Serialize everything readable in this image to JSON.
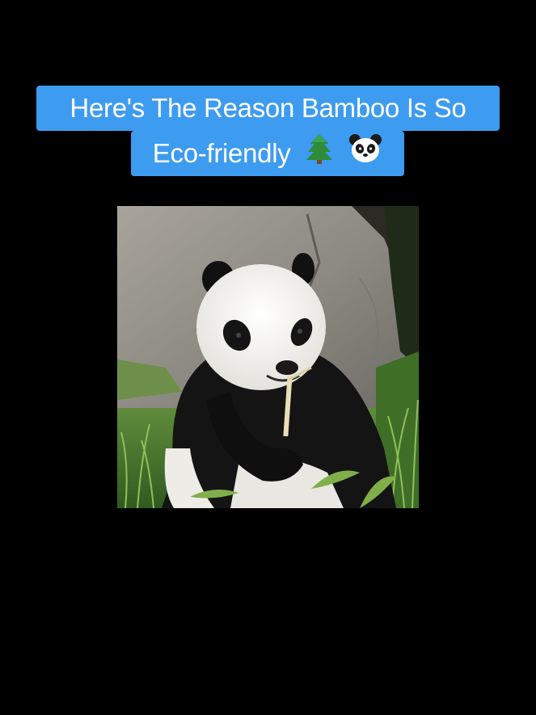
{
  "caption": {
    "line1": "Here's The Reason Bamboo Is So",
    "line2": "Eco-friendly",
    "emojis": [
      "evergreen-tree-icon",
      "panda-face-icon"
    ],
    "background_color": "#3d9bf0",
    "text_color": "#ffffff"
  },
  "background_color": "#000000"
}
